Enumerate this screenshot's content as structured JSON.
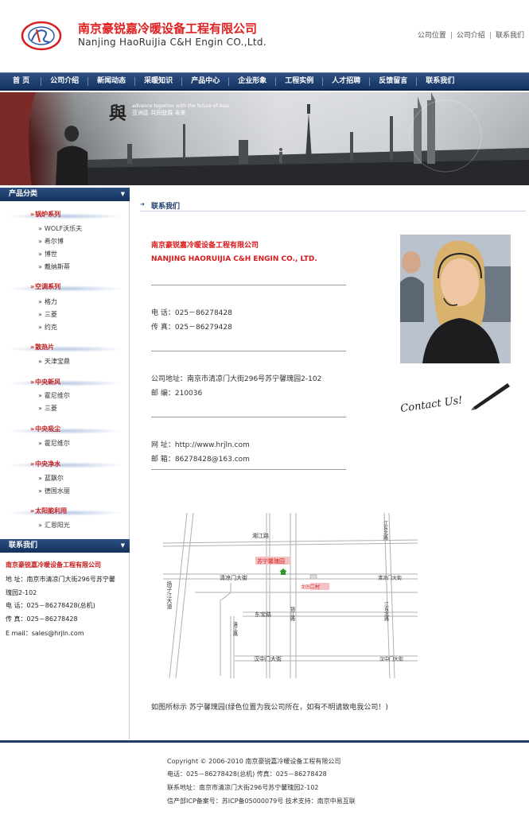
{
  "header": {
    "company_cn": "南京豪锐嘉冷暖设备工程有限公司",
    "company_en": "Nanjing HaoRuiJia C&H Engin CO.,Ltd.",
    "links": [
      "公司位置",
      "公司介绍",
      "联系我们"
    ]
  },
  "nav": [
    "首 页",
    "公司介绍",
    "新闻动态",
    "采暖知识",
    "产品中心",
    "企业形象",
    "工程实例",
    "人才招聘",
    "反馈留言",
    "联系我们"
  ],
  "banner": {
    "mark": "與",
    "slogan_cn": "亚洲區 共同發展 未来",
    "slogan_en": "advance together with the future of Asia"
  },
  "sidebar": {
    "products_title": "产品分类",
    "categories": [
      {
        "name": "锅炉系列",
        "items": [
          "WOLF沃乐夫",
          "希尔博",
          "博世",
          "戴纳斯蒂"
        ]
      },
      {
        "name": "空调系列",
        "items": [
          "格力",
          "三菱",
          "约克"
        ]
      },
      {
        "name": "散热片",
        "items": [
          "天津宝鼎"
        ]
      },
      {
        "name": "中央新风",
        "items": [
          "霍尼维尔",
          "三菱"
        ]
      },
      {
        "name": "中央吸尘",
        "items": [
          "霍尼维尔"
        ]
      },
      {
        "name": "中央净水",
        "items": [
          "蓝飘尔",
          "德国水丽"
        ]
      },
      {
        "name": "太阳能利用",
        "items": [
          "汇恩阳光"
        ]
      }
    ],
    "contact_title": "联系我们",
    "contact": {
      "company": "南京豪锐嘉冷暖设备工程有限公司",
      "address_label": "地  址：",
      "address": "南京市清凉门大街296号苏宁馨",
      "address2": "瑰园2-102",
      "phone": "电  话：025－86278428(总机)",
      "fax": "传  真：025－86278428",
      "email": "E mail：sales@hrjln.com"
    }
  },
  "main": {
    "title": "联系我们",
    "company_cn": "南京豪锐嘉冷暖设备工程有限公司",
    "company_en": "NANJING HAORUIJIA C&H ENGIN CO., LTD.",
    "phone": "电     话：025－86278428",
    "fax": "传     真：025－86279428",
    "address": "公司地址：南京市清凉门大街296号苏宁馨瑰园2-102",
    "postcode": "邮     编：210036",
    "website": "网     址：http://www.hrjln.com",
    "email": "邮     箱：86278428@163.com",
    "signature": "Contact Us!",
    "map_note": "如图所标示 苏宁馨瑰园(绿色位置为我公司所在，如有不明请致电我公司！)"
  },
  "map": {
    "labels": [
      "湘江路",
      "江东北路",
      "苏宁馨瑰园",
      "清凉门大街",
      "清凉门大街",
      "龙园二村",
      "扬子江大道",
      "东宝路",
      "锦江路",
      "清江路",
      "江东北路",
      "汉中门大街",
      "汉中门大街"
    ]
  },
  "footer": {
    "line1": "Copyright © 2006-2010 南京豪锐嘉冷暖设备工程有限公司",
    "line2": "电话：025－86278428(总机)   传真：025－86278428",
    "line3": "联系地址：南京市清凉门大街296号苏宁馨瑰园2-102",
    "line4": "信产部ICP备案号：苏ICP备05000079号   技术支持：南京中易互联"
  }
}
